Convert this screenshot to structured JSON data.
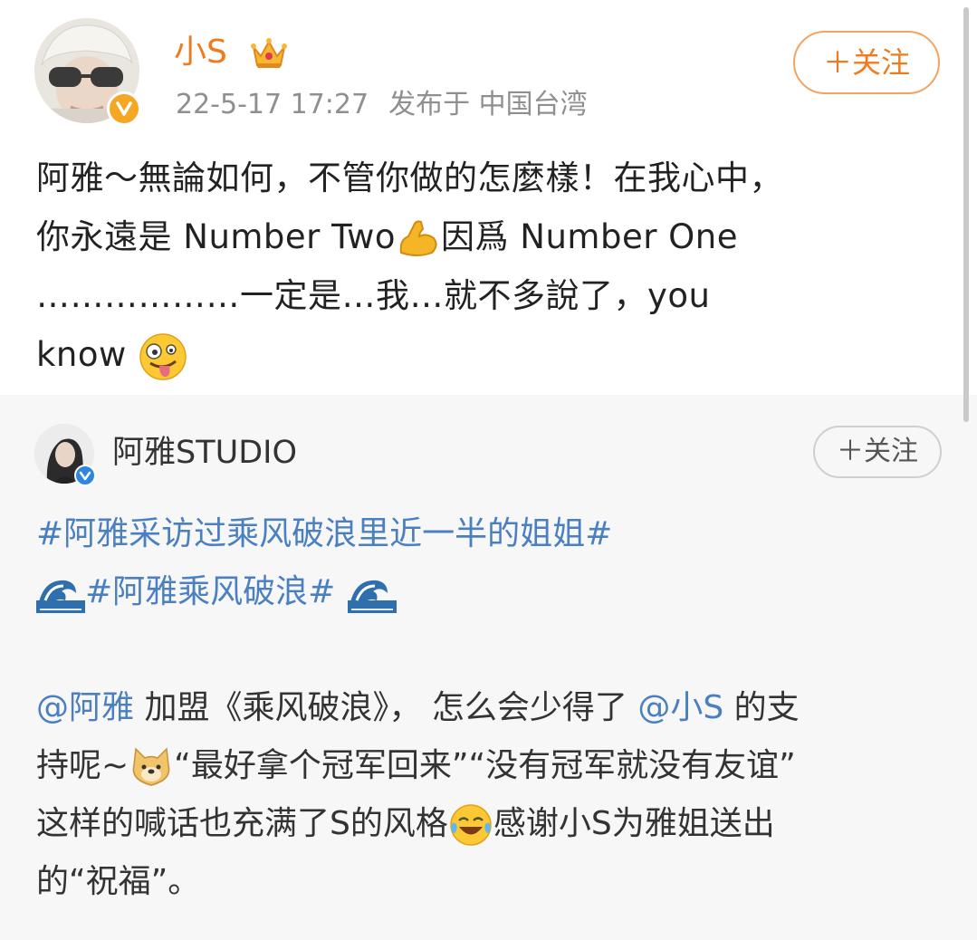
{
  "post": {
    "author": "小S",
    "time": "22-5-17 17:27",
    "location": "发布于 中国台湾",
    "follow_label": "＋关注",
    "lines": [
      [
        "阿雅～無論如何，不管你做的怎麼樣！在我心中，"
      ],
      [
        "你永遠是 Number Two",
        "因爲 Number One"
      ],
      [
        "………………一定是…我…就不多說了，you"
      ],
      [
        "know "
      ]
    ]
  },
  "repost": {
    "author": "阿雅STUDIO",
    "follow_label": "＋关注",
    "tag1": "#阿雅采访过乘风破浪里近一半的姐姐#",
    "tag2": "#阿雅乘风破浪#",
    "body": {
      "mention1": "@阿雅",
      "t1": " 加盟《乘风破浪》， 怎么会少得了 ",
      "mention2": "@小S",
      "t2": " 的支",
      "t3": "持呢~",
      "t4": "“最好拿个冠军回来”“没有冠军就没有友谊”",
      "t5": "这样的喊话也充满了S的风格",
      "t6": "感谢小S为雅姐送出",
      "t7": "的“祝福”。"
    }
  },
  "icons": {
    "crown": "crown-icon",
    "verified": "verified-badge-icon",
    "muscle": "flexed-biceps-icon",
    "zany": "zany-face-icon",
    "wave": "wave-icon",
    "doge": "doge-icon",
    "laugh": "laugh-cry-icon"
  },
  "colors": {
    "accent": "#f07b1e",
    "link": "#4a7fc1",
    "meta": "#8f8f8f",
    "repost_bg": "#f7f7f7"
  }
}
